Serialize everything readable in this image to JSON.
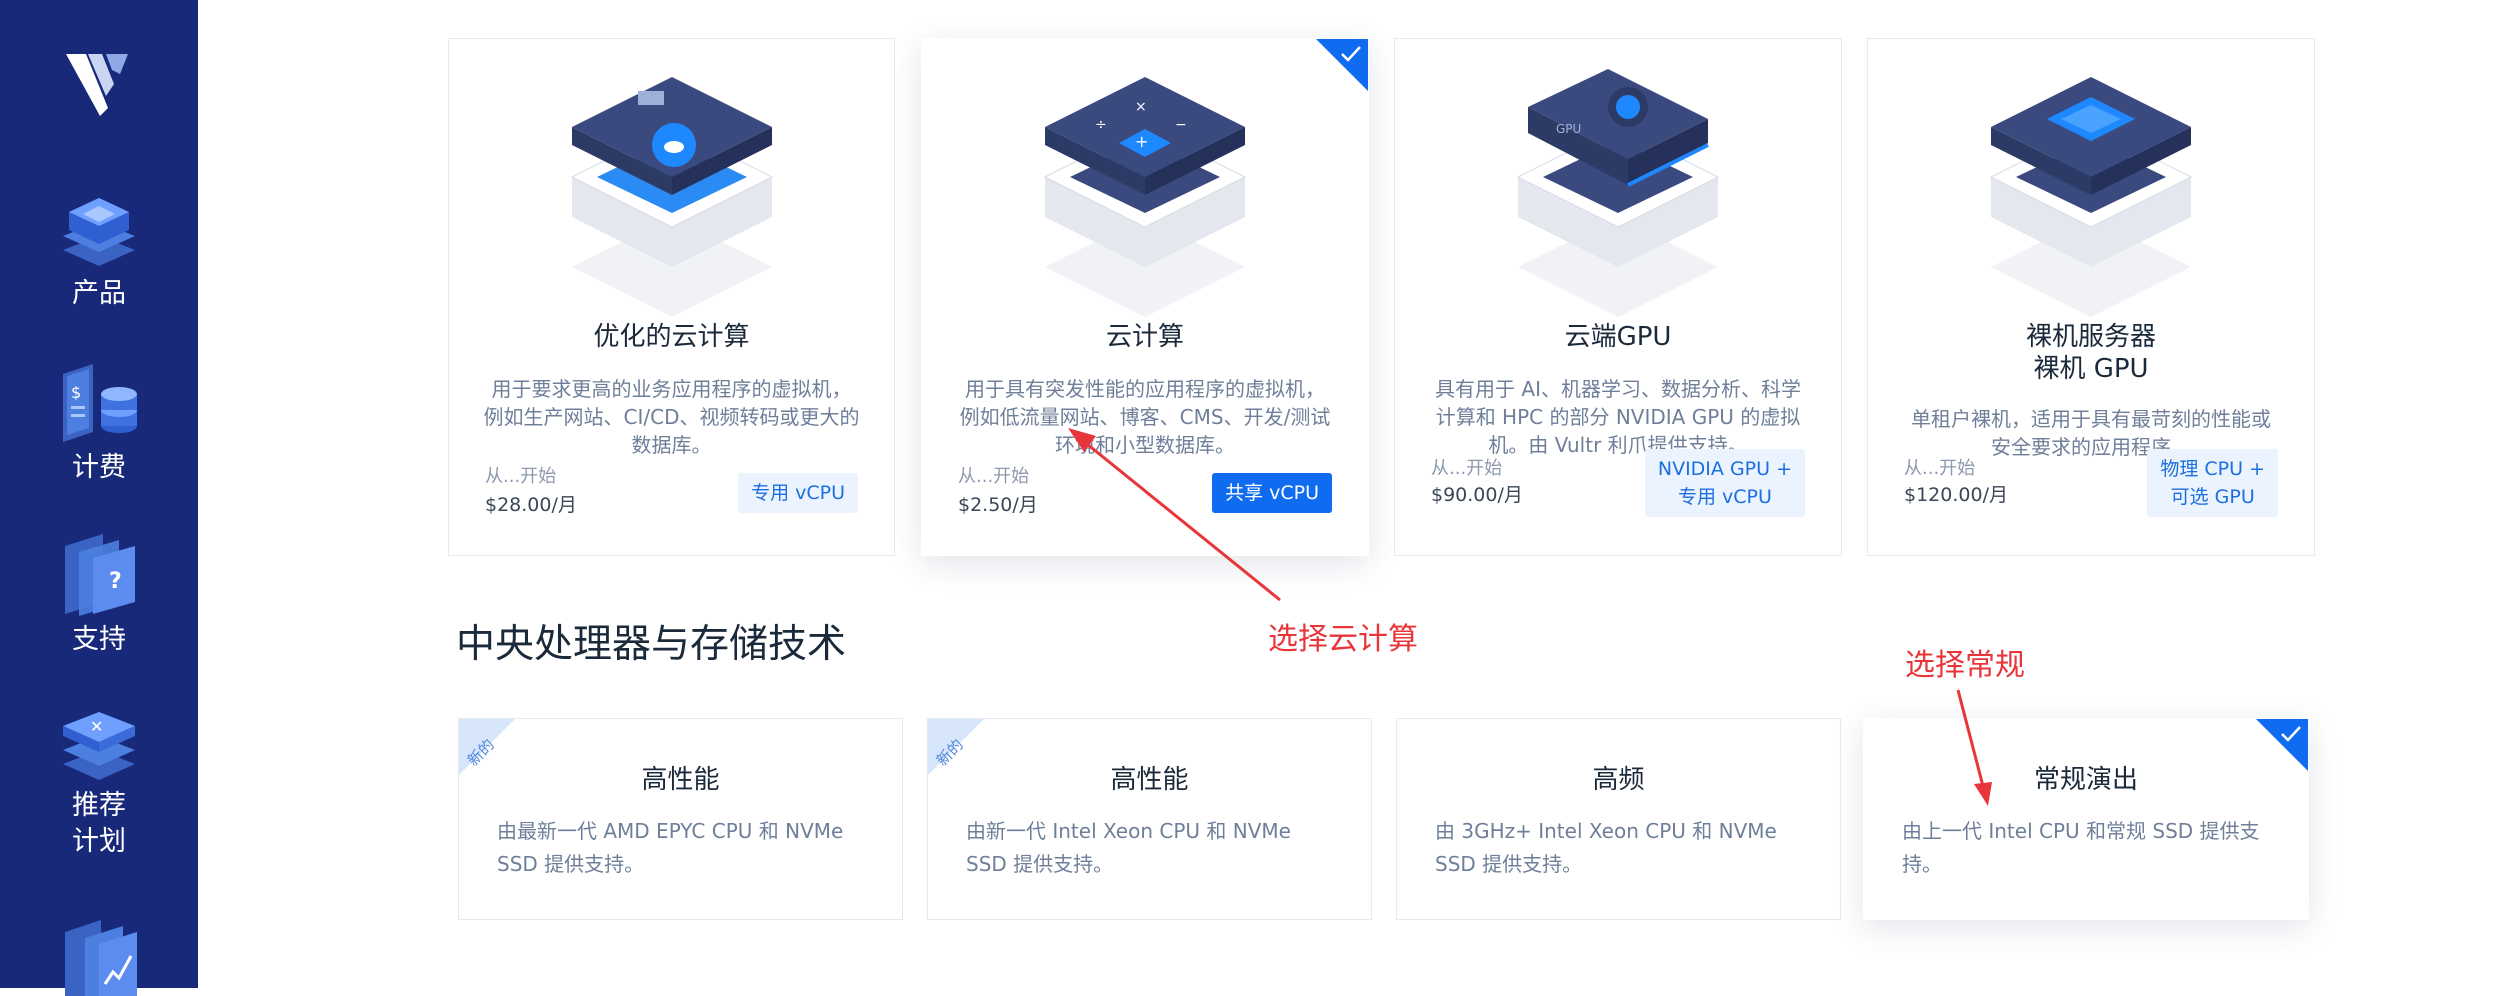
{
  "sidebar": {
    "items": [
      {
        "label": "产品",
        "icon": "layers-icon"
      },
      {
        "label": "计费",
        "icon": "billing-icon"
      },
      {
        "label": "支持",
        "icon": "help-document-icon"
      },
      {
        "label": "推荐\n计划",
        "label_lines": [
          "推荐",
          "计划"
        ],
        "icon": "referral-icon"
      },
      {
        "label": "",
        "icon": "chart-document-icon"
      }
    ]
  },
  "products": [
    {
      "title": "优化的云计算",
      "desc": "用于要求更高的业务应用程序的虚拟机，例如生产网站、CI/CD、视频转码或更大的数据库。",
      "price_from": "从...开始",
      "price": "$28.00/月",
      "badge_lines": [
        "专用 vCPU"
      ],
      "selected": false
    },
    {
      "title": "云计算",
      "desc": "用于具有突发性能的应用程序的虚拟机，例如低流量网站、博客、CMS、开发/测试环境和小型数据库。",
      "price_from": "从...开始",
      "price": "$2.50/月",
      "badge_lines": [
        "共享 vCPU"
      ],
      "selected": true
    },
    {
      "title": "云端GPU",
      "desc": "具有用于 AI、机器学习、数据分析、科学计算和 HPC 的部分 NVIDIA GPU 的虚拟机。由 Vultr 利爪提供支持。",
      "price_from": "从...开始",
      "price": "$90.00/月",
      "badge_lines": [
        "NVIDIA GPU +",
        "专用 vCPU"
      ],
      "selected": false
    },
    {
      "title_lines": [
        "裸机服务器",
        "裸机 GPU"
      ],
      "desc": "单租户裸机，适用于具有最苛刻的性能或安全要求的应用程序。",
      "price_from": "从...开始",
      "price": "$120.00/月",
      "badge_lines": [
        "物理 CPU +",
        "可选 GPU"
      ],
      "selected": false
    }
  ],
  "section": {
    "title": "中央处理器与存储技术"
  },
  "cpu_options": [
    {
      "tag": "新的",
      "title": "高性能",
      "desc": "由最新一代 AMD EPYC CPU 和 NVMe SSD 提供支持。",
      "selected": false
    },
    {
      "tag": "新的",
      "title": "高性能",
      "desc": "由新一代 Intel Xeon CPU 和 NVMe SSD 提供支持。",
      "selected": false
    },
    {
      "tag": "",
      "title": "高频",
      "desc": "由 3GHz+ Intel Xeon CPU 和 NVMe SSD 提供支持。",
      "selected": false
    },
    {
      "tag": "",
      "title": "常规演出",
      "desc": "由上一代 Intel CPU 和常规 SSD 提供支持。",
      "selected": true
    }
  ],
  "annotations": {
    "cloud_compute": "选择云计算",
    "regular": "选择常规"
  },
  "colors": {
    "sidebar": "#18297a",
    "accent": "#0f6cf0",
    "annotation": "#e8353a"
  }
}
